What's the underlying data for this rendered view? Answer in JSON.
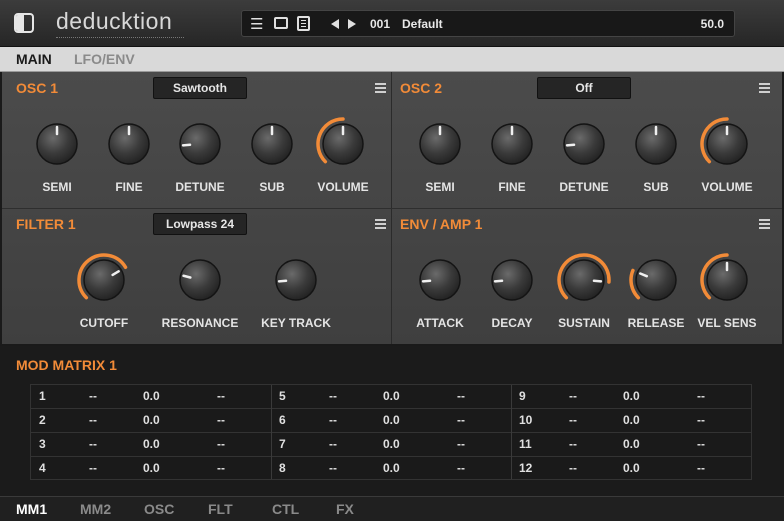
{
  "header": {
    "title": "deducktion",
    "preset_number": "001",
    "preset_name": "Default",
    "preset_value": "50.0"
  },
  "top_tabs": [
    {
      "label": "MAIN",
      "active": true
    },
    {
      "label": "LFO/ENV",
      "active": false
    }
  ],
  "sections": [
    {
      "id": "osc1",
      "title": "OSC 1",
      "dropdown": "Sawtooth",
      "knobs": [
        {
          "label": "SEMI",
          "value": 0.5,
          "ring": false
        },
        {
          "label": "FINE",
          "value": 0.5,
          "ring": false
        },
        {
          "label": "DETUNE",
          "value": 0.15,
          "ring": false
        },
        {
          "label": "SUB",
          "value": 0.5,
          "ring": false
        },
        {
          "label": "VOLUME",
          "value": 0.5,
          "ring": true
        }
      ]
    },
    {
      "id": "osc2",
      "title": "OSC 2",
      "dropdown": "Off",
      "knobs": [
        {
          "label": "SEMI",
          "value": 0.5,
          "ring": false
        },
        {
          "label": "FINE",
          "value": 0.5,
          "ring": false
        },
        {
          "label": "DETUNE",
          "value": 0.15,
          "ring": false
        },
        {
          "label": "SUB",
          "value": 0.5,
          "ring": false
        },
        {
          "label": "VOLUME",
          "value": 0.5,
          "ring": true
        }
      ]
    },
    {
      "id": "filter1",
      "title": "FILTER 1",
      "dropdown": "Lowpass 24",
      "knobs": [
        {
          "label": "CUTOFF",
          "value": 0.72,
          "ring": true
        },
        {
          "label": "RESONANCE",
          "value": 0.22,
          "ring": false
        },
        {
          "label": "KEY TRACK",
          "value": 0.15,
          "ring": false
        }
      ]
    },
    {
      "id": "envamp1",
      "title": "ENV / AMP 1",
      "dropdown": null,
      "knobs": [
        {
          "label": "ATTACK",
          "value": 0.15,
          "ring": false
        },
        {
          "label": "DECAY",
          "value": 0.15,
          "ring": false
        },
        {
          "label": "SUSTAIN",
          "value": 0.85,
          "ring": true
        },
        {
          "label": "RELEASE",
          "value": 0.25,
          "ring": true
        },
        {
          "label": "VEL SENS",
          "value": 0.5,
          "ring": true
        }
      ]
    }
  ],
  "mod_matrix": {
    "title": "MOD MATRIX 1",
    "rows": [
      [
        "1",
        "--",
        "0.0",
        "--"
      ],
      [
        "2",
        "--",
        "0.0",
        "--"
      ],
      [
        "3",
        "--",
        "0.0",
        "--"
      ],
      [
        "4",
        "--",
        "0.0",
        "--"
      ],
      [
        "5",
        "--",
        "0.0",
        "--"
      ],
      [
        "6",
        "--",
        "0.0",
        "--"
      ],
      [
        "7",
        "--",
        "0.0",
        "--"
      ],
      [
        "8",
        "--",
        "0.0",
        "--"
      ],
      [
        "9",
        "--",
        "0.0",
        "--"
      ],
      [
        "10",
        "--",
        "0.0",
        "--"
      ],
      [
        "11",
        "--",
        "0.0",
        "--"
      ],
      [
        "12",
        "--",
        "0.0",
        "--"
      ]
    ]
  },
  "bottom_tabs": [
    {
      "label": "MM1",
      "active": true
    },
    {
      "label": "MM2",
      "active": false
    },
    {
      "label": "OSC",
      "active": false
    },
    {
      "label": "FLT",
      "active": false
    },
    {
      "label": "CTL",
      "active": false
    },
    {
      "label": "FX",
      "active": false
    }
  ],
  "colors": {
    "accent": "#f28b38",
    "active_tab": "#1a1a1a",
    "inactive_tab": "#8a8a8a"
  }
}
